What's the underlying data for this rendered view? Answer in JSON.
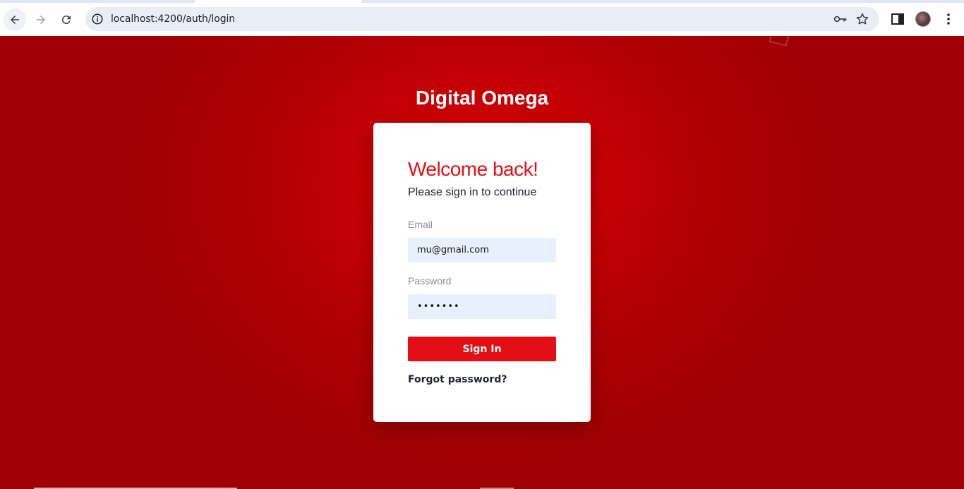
{
  "browser": {
    "url": "localhost:4200/auth/login",
    "icons": {
      "back": "back-arrow-icon",
      "forward": "forward-arrow-icon",
      "reload": "reload-icon",
      "info": "info-icon",
      "password_key": "key-icon",
      "bookmark": "star-icon",
      "side_panel": "side-panel-icon",
      "profile": "avatar",
      "menu": "more-vertical-icon"
    }
  },
  "page": {
    "brand": "Digital Omega",
    "colors": {
      "background": "#c40005",
      "accent": "#e30f14",
      "input_bg": "#e8f0fe"
    }
  },
  "login": {
    "heading": "Welcome back!",
    "subheading": "Please sign in to continue",
    "email_label": "Email",
    "email_value": "mu@gmail.com",
    "password_label": "Password",
    "password_value": "•••••••",
    "signin_label": "Sign In",
    "forgot_label": "Forgot password?"
  }
}
